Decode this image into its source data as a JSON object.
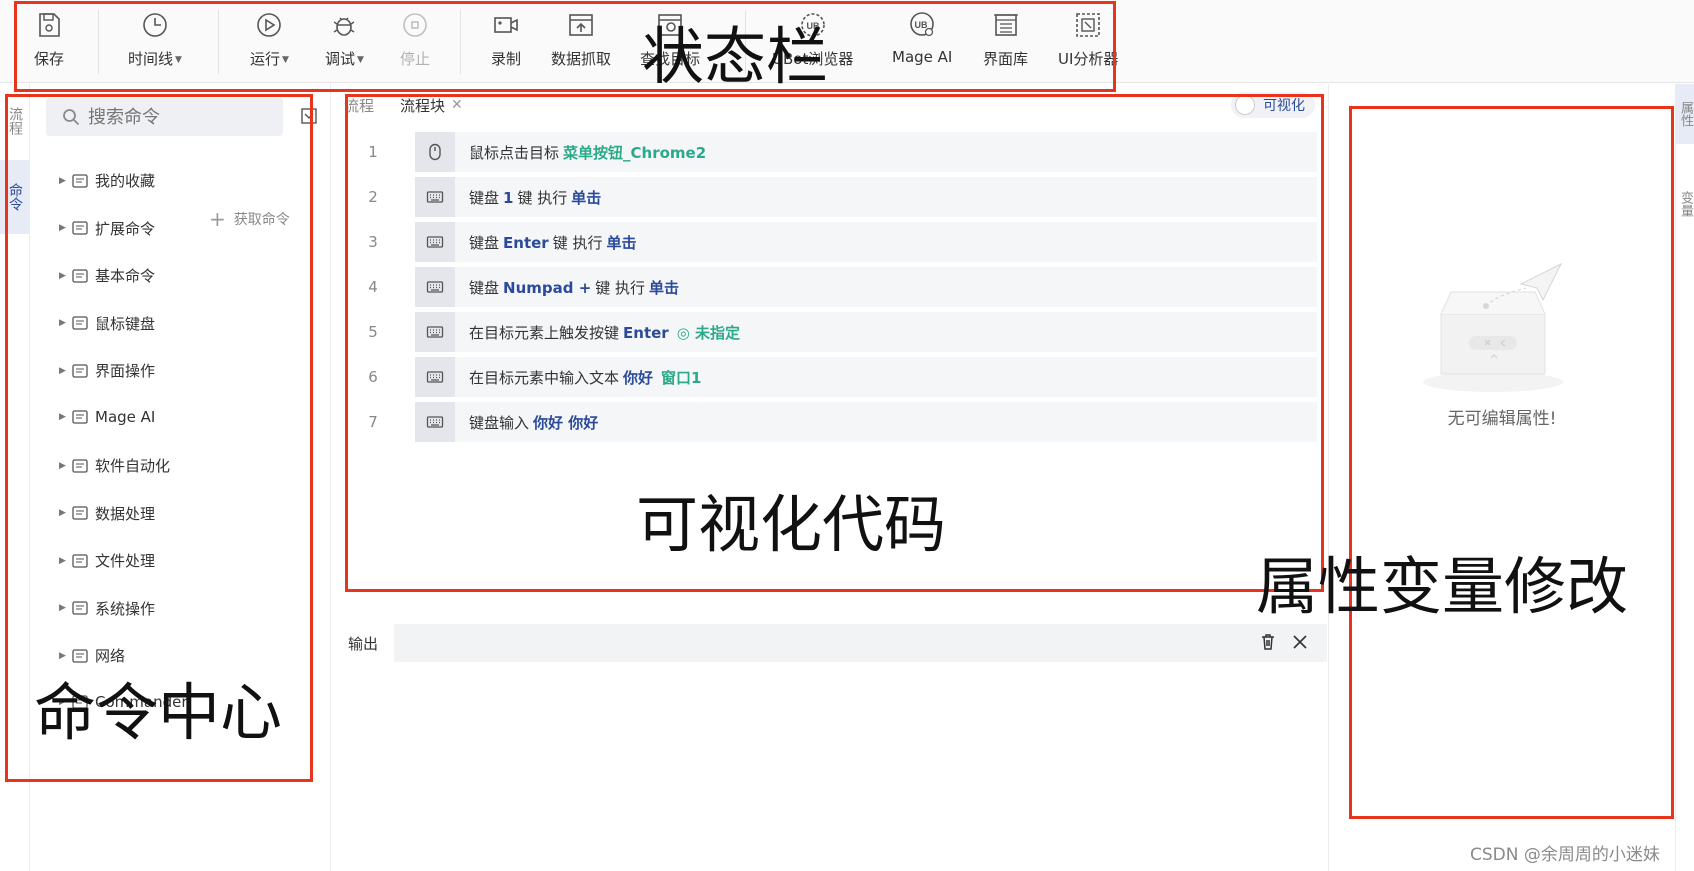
{
  "toolbar": {
    "buttons": [
      {
        "label": "保存",
        "icon": "save-icon"
      },
      {
        "label": "时间线",
        "icon": "clock-icon"
      },
      {
        "label": "运行",
        "icon": "play-icon"
      },
      {
        "label": "调试",
        "icon": "bug-icon"
      },
      {
        "label": "停止",
        "icon": "stop-icon"
      },
      {
        "label": "录制",
        "icon": "record-icon"
      },
      {
        "label": "数据抓取",
        "icon": "data-scrape-icon"
      },
      {
        "label": "查找目标",
        "icon": "find-target-icon"
      },
      {
        "label": "UBot浏览器",
        "icon": "ubot-browser-icon"
      },
      {
        "label": "Mage AI",
        "icon": "mage-ai-icon"
      },
      {
        "label": "界面库",
        "icon": "ui-library-icon"
      },
      {
        "label": "UI分析器",
        "icon": "ui-analyzer-icon"
      }
    ]
  },
  "left_tabs": [
    "流程",
    "命令"
  ],
  "command_panel": {
    "search_placeholder": "搜索命令",
    "fetch_label": "获取命令",
    "items": [
      {
        "label": "我的收藏",
        "icon": "folder-icon"
      },
      {
        "label": "扩展命令",
        "icon": "extension-icon"
      },
      {
        "label": "基本命令",
        "icon": "code-icon"
      },
      {
        "label": "鼠标键盘",
        "icon": "keyboard-mouse-icon"
      },
      {
        "label": "界面操作",
        "icon": "window-icon"
      },
      {
        "label": "Mage AI",
        "icon": "mage-ai-icon"
      },
      {
        "label": "软件自动化",
        "icon": "automation-icon"
      },
      {
        "label": "数据处理",
        "icon": "pie-icon"
      },
      {
        "label": "文件处理",
        "icon": "file-icon"
      },
      {
        "label": "系统操作",
        "icon": "system-icon"
      },
      {
        "label": "网络",
        "icon": "globe-icon"
      },
      {
        "label": "Commander",
        "icon": "commander-icon"
      }
    ]
  },
  "editor": {
    "tabs": [
      {
        "label": "流程",
        "closable": false
      },
      {
        "label": "流程块",
        "closable": true
      }
    ],
    "toggle_label": "可视化",
    "rows": [
      {
        "num": "1",
        "icon": "mouse-icon",
        "parts": [
          [
            "t",
            "鼠标点击目标"
          ],
          [
            "g",
            "菜单按钮_Chrome2"
          ]
        ]
      },
      {
        "num": "2",
        "icon": "keyboard-icon",
        "parts": [
          [
            "t",
            "键盘"
          ],
          [
            "k",
            "1"
          ],
          [
            "t",
            "键 执行"
          ],
          [
            "k",
            "单击"
          ]
        ]
      },
      {
        "num": "3",
        "icon": "keyboard-icon",
        "parts": [
          [
            "t",
            "键盘"
          ],
          [
            "k",
            "Enter"
          ],
          [
            "t",
            "键 执行"
          ],
          [
            "k",
            "单击"
          ]
        ]
      },
      {
        "num": "4",
        "icon": "keyboard-icon",
        "parts": [
          [
            "t",
            "键盘"
          ],
          [
            "k",
            "Numpad +"
          ],
          [
            "t",
            "键 执行"
          ],
          [
            "k",
            "单击"
          ]
        ]
      },
      {
        "num": "5",
        "icon": "keyboard-icon",
        "parts": [
          [
            "t",
            "在目标元素上触发按键"
          ],
          [
            "k",
            "Enter"
          ],
          [
            "g",
            "◎ 未指定"
          ]
        ]
      },
      {
        "num": "6",
        "icon": "keyboard-icon",
        "parts": [
          [
            "t",
            "在目标元素中输入文本"
          ],
          [
            "k",
            "你好"
          ],
          [
            "g",
            "窗口1"
          ]
        ]
      },
      {
        "num": "7",
        "icon": "keyboard-icon",
        "parts": [
          [
            "t",
            "键盘输入"
          ],
          [
            "k",
            "你好 你好"
          ]
        ]
      }
    ]
  },
  "output": {
    "tab_label": "输出"
  },
  "properties": {
    "empty_text": "无可编辑属性!"
  },
  "right_tabs": [
    "属性",
    "变量"
  ],
  "annotations": {
    "status_bar": "状态栏",
    "visual_code": "可视化代码",
    "command_center": "命令中心",
    "property_edit": "属性变量修改"
  },
  "watermark": "CSDN @余周周的小迷妹",
  "colors": {
    "keyword": "#2b4a9a",
    "target": "#2aaa8a",
    "annotation": "#e8341c"
  }
}
